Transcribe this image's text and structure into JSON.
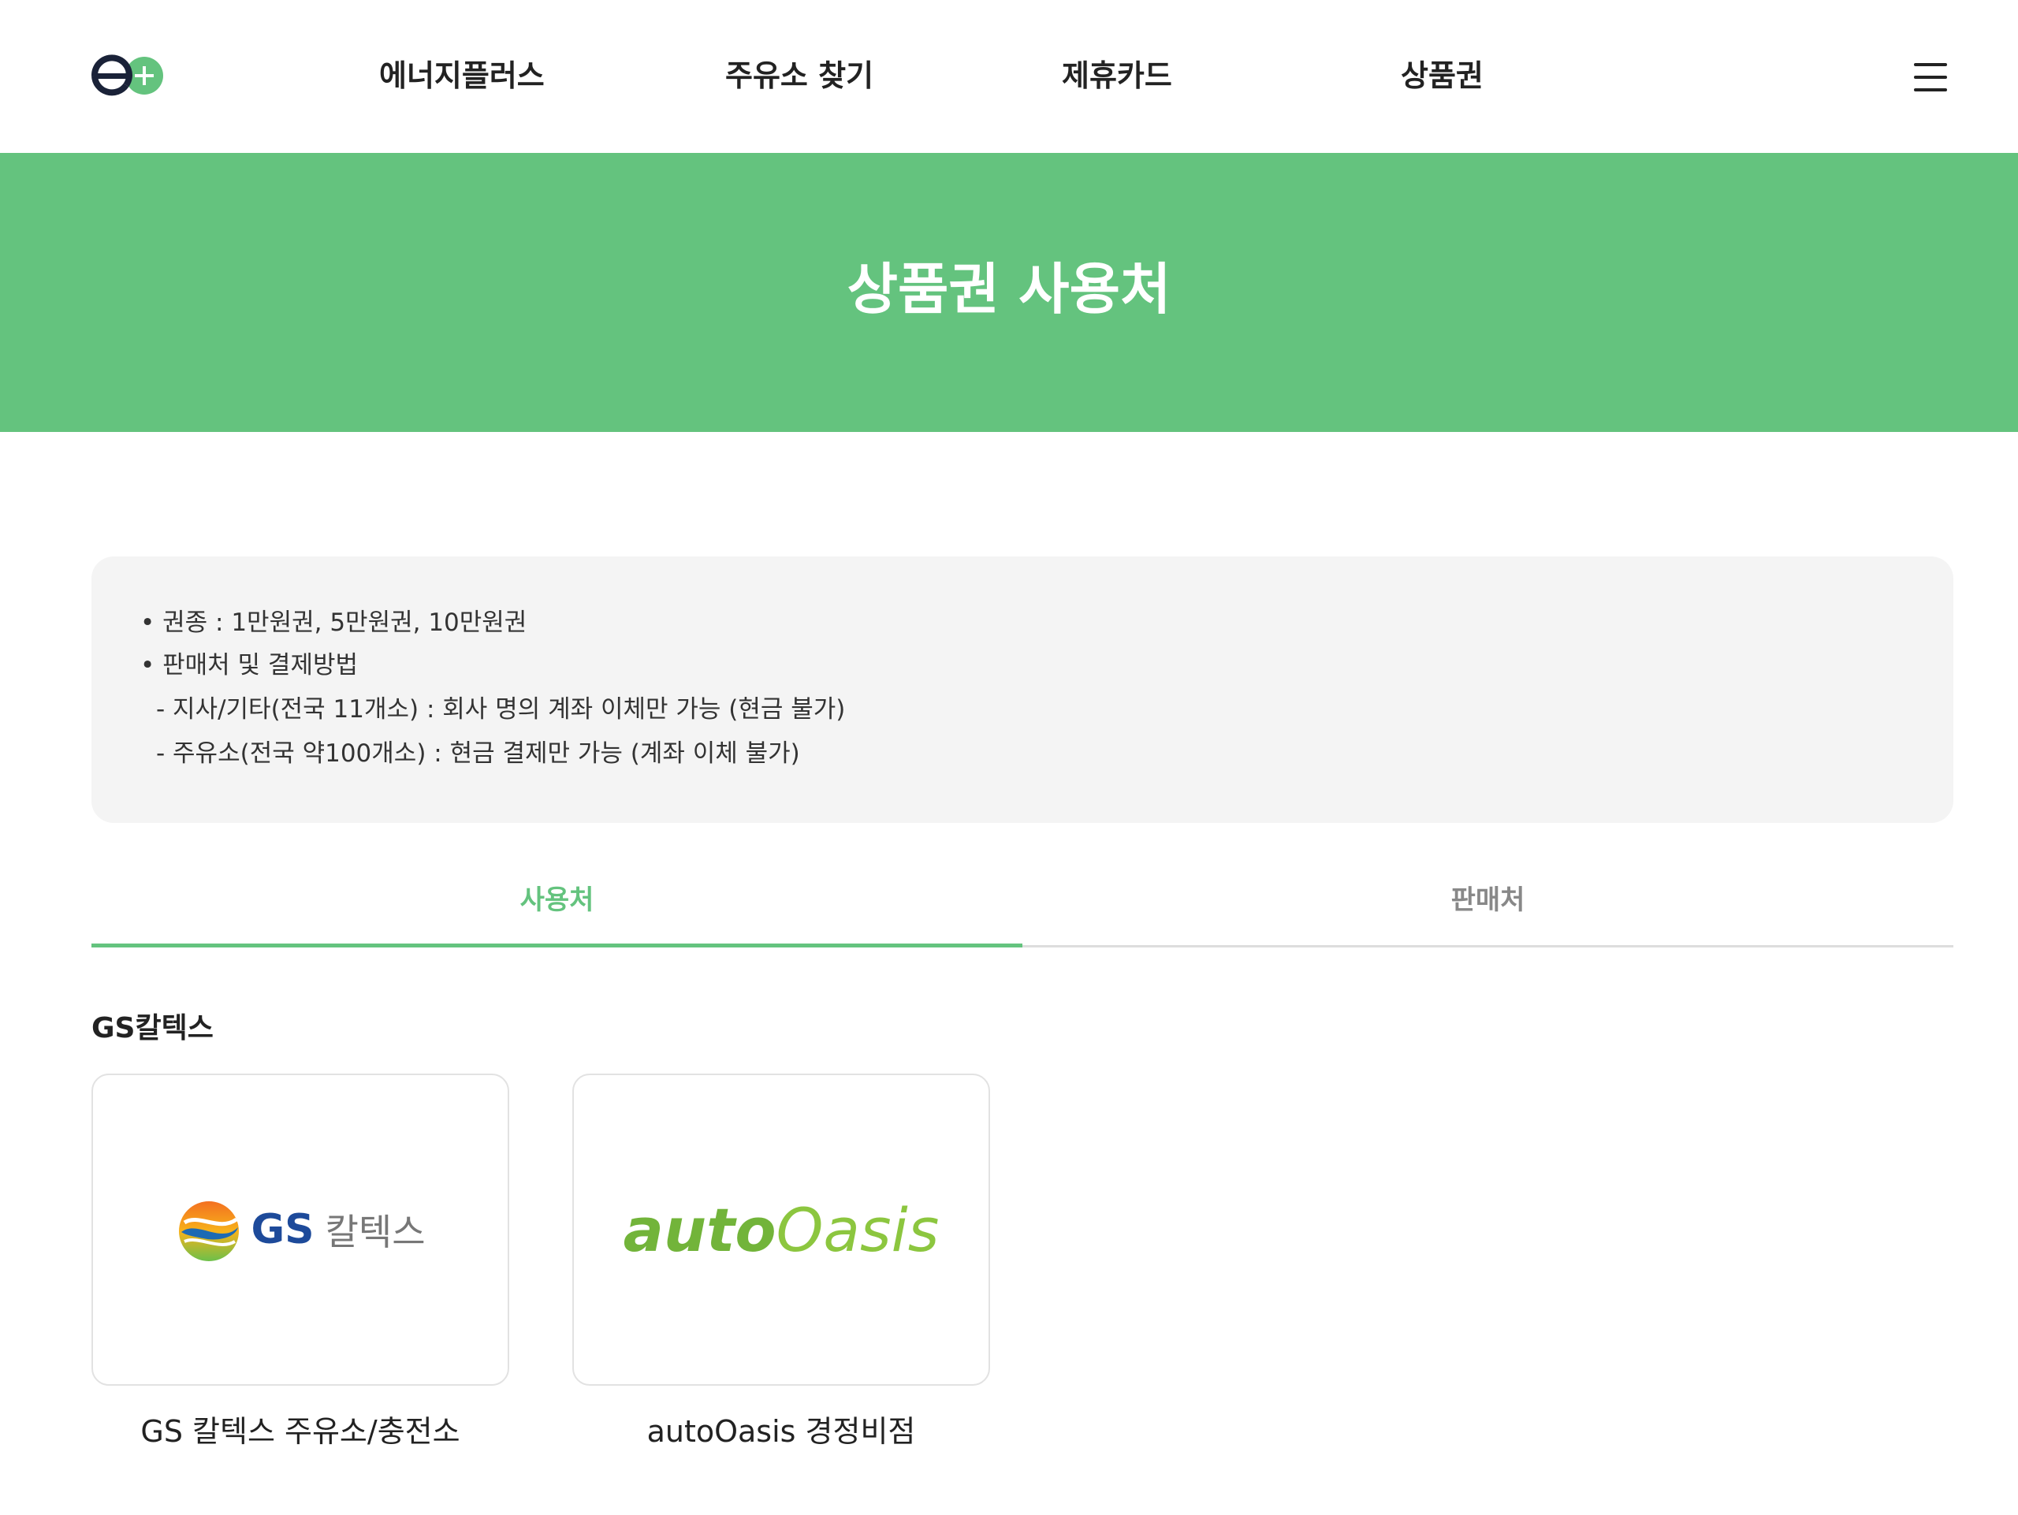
{
  "header": {
    "nav": [
      "에너지플러스",
      "주유소 찾기",
      "제휴카드",
      "상품권"
    ]
  },
  "banner": {
    "title": "상품권 사용처"
  },
  "info": {
    "lines": [
      "• 권종 : 1만원권, 5만원권, 10만원권",
      "• 판매처 및 결제방법",
      "- 지사/기타(전국 11개소) : 회사 명의 계좌 이체만 가능 (현금 불가)",
      "- 주유소(전국 약100개소) : 현금 결제만 가능 (계좌 이체 불가)"
    ]
  },
  "tabs": {
    "use": "사용처",
    "sell": "판매처"
  },
  "section": {
    "title": "GS칼텍스",
    "cards": [
      {
        "logo_gs": "GS",
        "logo_kor": "칼텍스",
        "label": "GS 칼텍스 주유소/충전소"
      },
      {
        "logo_auto": "auto",
        "logo_oasis": "Oasis",
        "label": "autoOasis 경정비점"
      }
    ]
  },
  "colors": {
    "accent": "#64c37e",
    "gs_blue": "#1d4a9a",
    "ao_green": "#72b43a"
  }
}
